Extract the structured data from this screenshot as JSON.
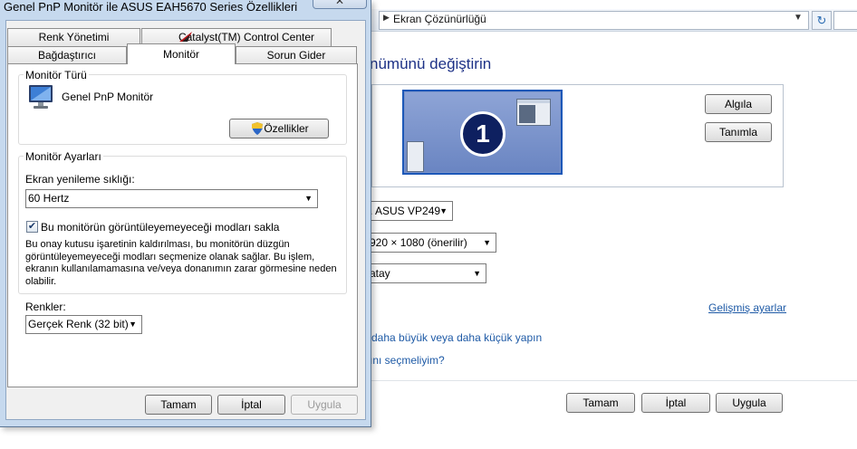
{
  "background_window": {
    "address_bar": {
      "path": "Ekran Çözünürlüğü"
    },
    "heading": "nümünü değiştirin",
    "monitor_number": "1",
    "buttons": {
      "detect": "Algıla",
      "identify": "Tanımla",
      "ok": "Tamam",
      "cancel": "İptal",
      "apply": "Uygula"
    },
    "display_value": ". ASUS VP249",
    "resolution_value": "920 × 1080 (önerilir)",
    "orientation_value": "atay",
    "advanced_link": "Gelişmiş ayarlar",
    "link_size": "i daha büyük veya daha küçük yapın",
    "link_choose": "rını seçmeliyim?"
  },
  "dialog": {
    "title": "Genel PnP Monitör ile ASUS EAH5670 Series Özellikleri",
    "close_glyph": "✕",
    "tabs": {
      "color_management": "Renk Yönetimi",
      "catalyst": "Catalyst(TM) Control Center",
      "adapter": "Bağdaştırıcı",
      "monitor": "Monitör",
      "troubleshoot": "Sorun Gider"
    },
    "monitor_type": {
      "group_label": "Monitör Türü",
      "monitor_name": "Genel PnP Monitör",
      "properties_button": "Özellikler"
    },
    "monitor_settings": {
      "group_label": "Monitör Ayarları",
      "refresh_label": "Ekran yenileme sıklığı:",
      "refresh_value": "60 Hertz",
      "hide_modes_checked": true,
      "hide_modes_label": "Bu monitörün görüntüleyemeyeceği modları sakla",
      "hide_modes_description": "Bu onay kutusu işaretinin kaldırılması, bu monitörün düzgün görüntüleyemeyeceği modları seçmenize olanak sağlar. Bu işlem, ekranın kullanılamamasına ve/veya donanımın zarar görmesine neden olabilir."
    },
    "colors": {
      "label": "Renkler:",
      "value": "Gerçek Renk (32 bit)"
    },
    "buttons": {
      "ok": "Tamam",
      "cancel": "İptal",
      "apply": "Uygula"
    }
  }
}
